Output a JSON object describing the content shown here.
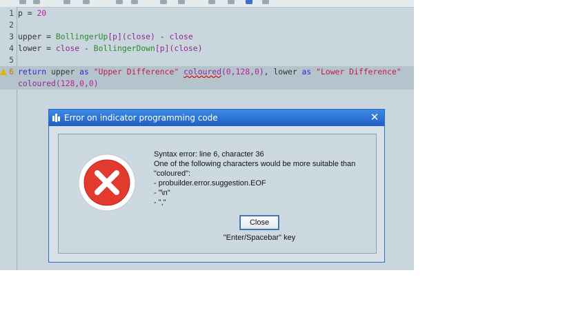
{
  "editor": {
    "lines": [
      {
        "num": "1",
        "tokens": [
          {
            "t": "p",
            "c": "plain"
          },
          {
            "t": " = ",
            "c": "plain"
          },
          {
            "t": "20",
            "c": "num"
          }
        ]
      },
      {
        "num": "2",
        "tokens": []
      },
      {
        "num": "3",
        "tokens": [
          {
            "t": "upper",
            "c": "plain"
          },
          {
            "t": " = ",
            "c": "plain"
          },
          {
            "t": "BollingerUp",
            "c": "fn"
          },
          {
            "t": "[p](close)",
            "c": "br"
          },
          {
            "t": " - ",
            "c": "plain"
          },
          {
            "t": "close",
            "c": "br"
          }
        ]
      },
      {
        "num": "4",
        "tokens": [
          {
            "t": "lower",
            "c": "plain"
          },
          {
            "t": " = ",
            "c": "plain"
          },
          {
            "t": "close",
            "c": "br"
          },
          {
            "t": " - ",
            "c": "plain"
          },
          {
            "t": "BollingerDown",
            "c": "fn"
          },
          {
            "t": "[p](close)",
            "c": "br"
          }
        ]
      },
      {
        "num": "5",
        "tokens": []
      },
      {
        "num": "6",
        "warn": true,
        "tokens": [
          {
            "t": "return",
            "c": "kw"
          },
          {
            "t": " upper ",
            "c": "plain"
          },
          {
            "t": "as",
            "c": "kw"
          },
          {
            "t": " ",
            "c": "plain"
          },
          {
            "t": "\"Upper Difference\"",
            "c": "str"
          },
          {
            "t": " ",
            "c": "plain"
          },
          {
            "t": "coloured",
            "c": "br err"
          },
          {
            "t": "(",
            "c": "br"
          },
          {
            "t": "0",
            "c": "num"
          },
          {
            "t": ",",
            "c": "br"
          },
          {
            "t": "128",
            "c": "num"
          },
          {
            "t": ",",
            "c": "br"
          },
          {
            "t": "0",
            "c": "num"
          },
          {
            "t": ")",
            "c": "br"
          },
          {
            "t": ", lower ",
            "c": "plain"
          },
          {
            "t": "as",
            "c": "kw"
          },
          {
            "t": " ",
            "c": "plain"
          },
          {
            "t": "\"Lower Difference\"",
            "c": "str"
          }
        ]
      },
      {
        "num": "",
        "tokens": [
          {
            "t": "coloured",
            "c": "br"
          },
          {
            "t": "(",
            "c": "br"
          },
          {
            "t": "128",
            "c": "num"
          },
          {
            "t": ",",
            "c": "br"
          },
          {
            "t": "0",
            "c": "num"
          },
          {
            "t": ",",
            "c": "br"
          },
          {
            "t": "0",
            "c": "num"
          },
          {
            "t": ")",
            "c": "br"
          }
        ]
      }
    ]
  },
  "dialog": {
    "title": "Error on indicator programming code",
    "message_lines": [
      "Syntax error: line 6, character 36",
      "One of the following characters would be more suitable than",
      "\"coloured\":",
      "- probuilder.error.suggestion.EOF",
      "- \"\\n\"",
      "- \",\""
    ],
    "close_label": "Close",
    "hint": "\"Enter/Spacebar\" key"
  },
  "colors": {
    "titlebar": "#2f74d8",
    "error_red": "#e23a2f",
    "editor_bg": "#c9d6dd"
  },
  "icons": {
    "title": "window-app-icon",
    "close": "close-icon",
    "error": "error-x-icon",
    "warning": "warning-triangle-icon"
  }
}
